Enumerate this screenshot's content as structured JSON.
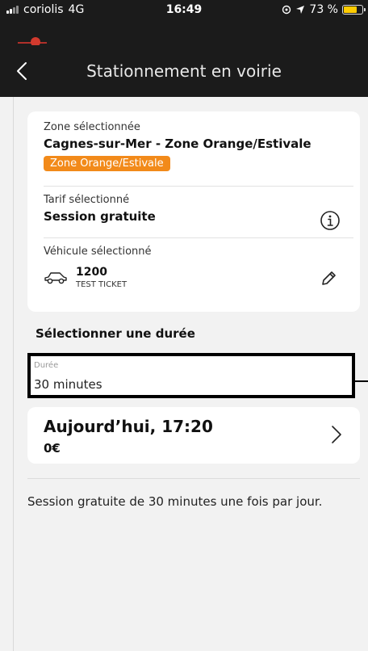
{
  "status_bar": {
    "carrier": "coriolis",
    "network": "4G",
    "time": "16:49",
    "battery": "73 %",
    "battery_level": 0.73
  },
  "nav": {
    "title": "Stationnement en voirie",
    "back_icon": "chevron-left-icon"
  },
  "zone": {
    "label": "Zone sélectionnée",
    "value": "Cagnes-sur-Mer - Zone Orange/Estivale",
    "badge": "Zone Orange/Estivale",
    "badge_color": "#f28a1a"
  },
  "tarif": {
    "label": "Tarif sélectionné",
    "value": "Session gratuite",
    "icon": "info-icon"
  },
  "vehicle": {
    "label": "Véhicule sélectionné",
    "plate": "1200",
    "name": "TEST TICKET",
    "icon": "car-icon",
    "edit_icon": "pencil-icon"
  },
  "duration": {
    "section_title": "Sélectionner une durée",
    "field_label": "Durée",
    "field_value": "30 minutes"
  },
  "schedule": {
    "when": "Aujourd’hui, 17:20",
    "price": "0€",
    "icon": "chevron-right-icon"
  },
  "footer_note": "Session gratuite de 30 minutes une fois par jour."
}
